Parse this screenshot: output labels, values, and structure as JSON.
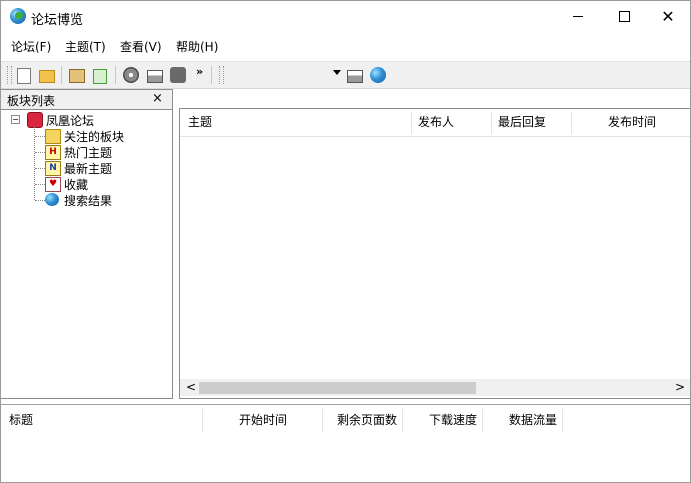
{
  "window": {
    "title": "论坛博览"
  },
  "menu": [
    "论坛(F)",
    "主题(T)",
    "查看(V)",
    "帮助(H)"
  ],
  "toolbar": {
    "overflow": "»"
  },
  "left_pane": {
    "title": "板块列表",
    "close": "×",
    "root": {
      "label": "凤凰论坛",
      "toggle": "−"
    },
    "items": [
      {
        "label": "关注的板块",
        "icon": "folder-icon"
      },
      {
        "label": "热门主题",
        "icon": "hot-topic-icon"
      },
      {
        "label": "最新主题",
        "icon": "new-topic-icon"
      },
      {
        "label": "收藏",
        "icon": "favorites-icon"
      },
      {
        "label": "搜索结果",
        "icon": "globe-icon"
      }
    ]
  },
  "topic_list": {
    "columns": [
      "主题",
      "发布人",
      "最后回复",
      "发布时间"
    ],
    "scroll_left": "<",
    "scroll_right": ">"
  },
  "download_list": {
    "columns": [
      "标题",
      "开始时间",
      "剩余页面数",
      "下载速度",
      "数据流量"
    ]
  }
}
